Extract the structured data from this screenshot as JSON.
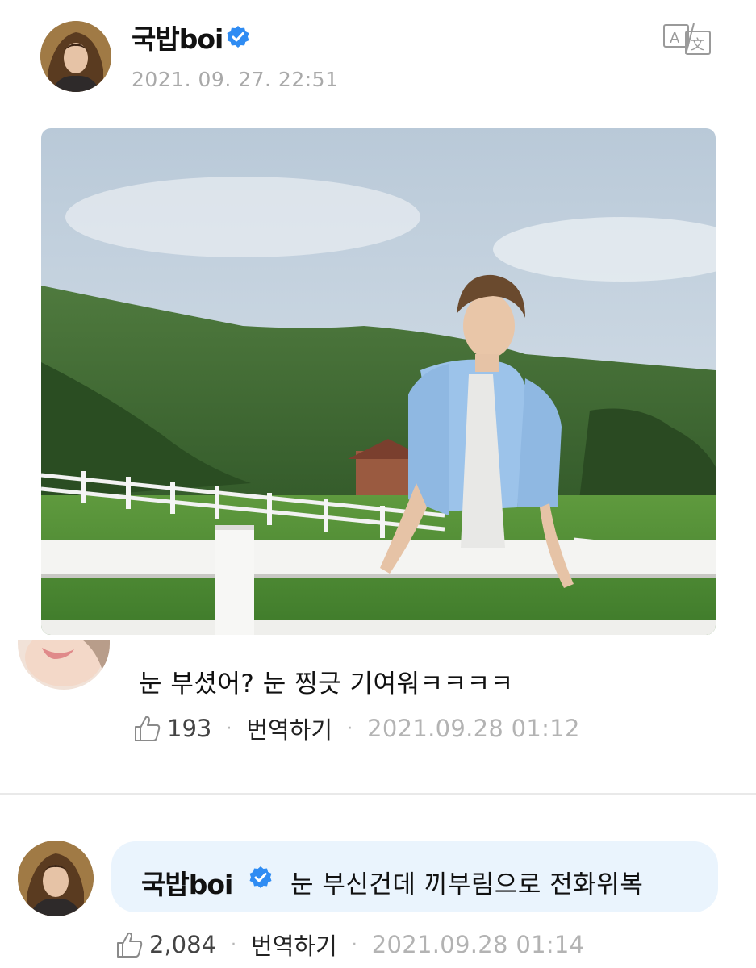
{
  "post": {
    "author": "국밥boi",
    "timestamp": "2021. 09. 27. 22:51",
    "translate_icon": "translate-icon",
    "verified_icon": "verified-badge-icon"
  },
  "comment": {
    "text": "눈 부셨어? 눈 찡긋 기여워ㅋㅋㅋㅋ",
    "likes": "193",
    "translate_label": "번역하기",
    "timestamp": "2021.09.28 01:12"
  },
  "reply": {
    "author": "국밥boi",
    "text": "눈 부신건데 끼부림으로 전화위복",
    "likes": "2,084",
    "translate_label": "번역하기",
    "timestamp": "2021.09.28 01:14"
  },
  "separator": "·",
  "colors": {
    "verified": "#2f8cf3",
    "reply_bubble": "#eaf4fd",
    "muted": "#a9a9a9"
  }
}
